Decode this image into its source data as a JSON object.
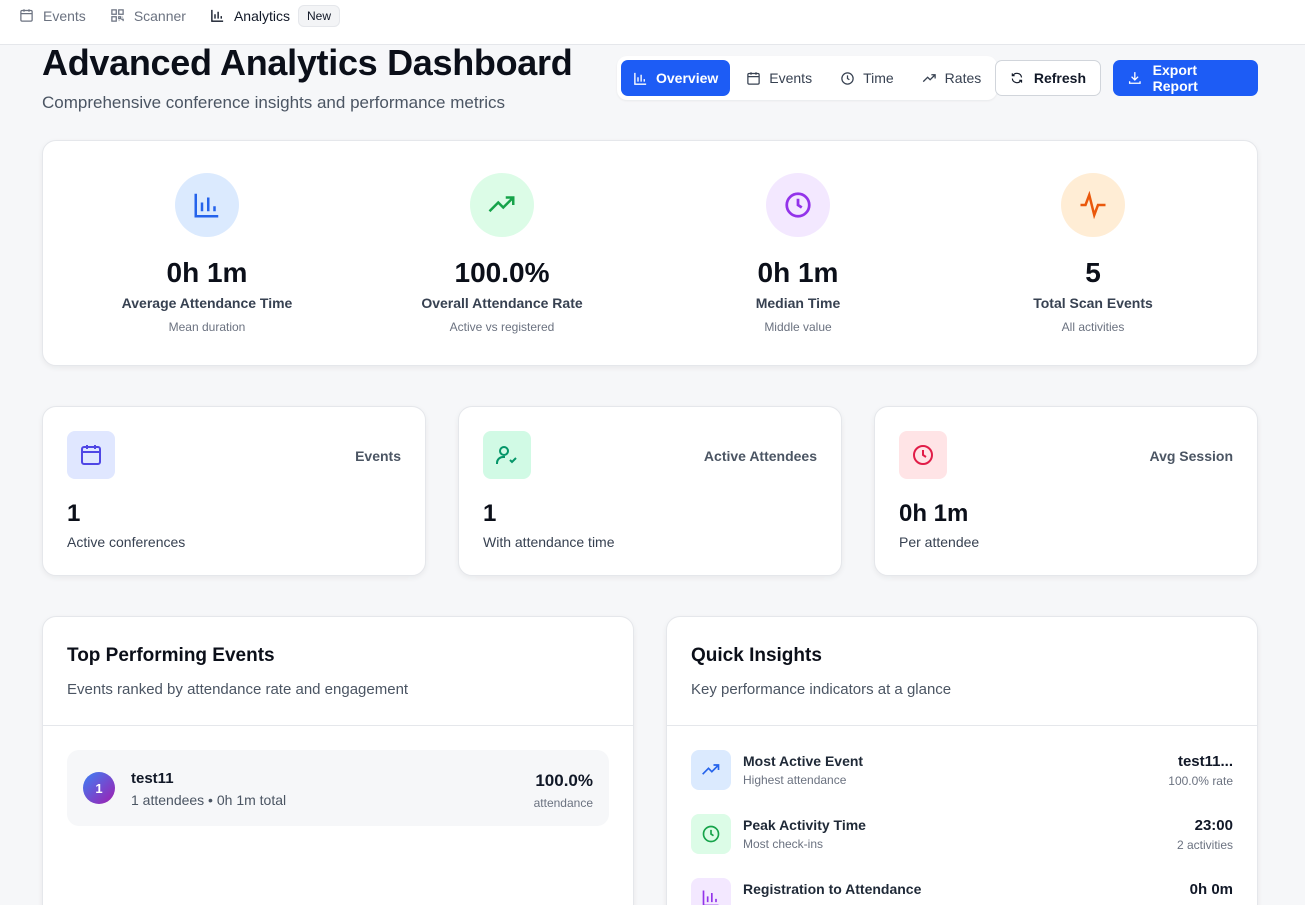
{
  "nav": {
    "items": [
      {
        "label": "Events",
        "icon": "calendar-icon"
      },
      {
        "label": "Scanner",
        "icon": "qr-code-icon"
      },
      {
        "label": "Analytics",
        "icon": "bar-chart-icon"
      }
    ],
    "badge": "New"
  },
  "header": {
    "title": "Advanced Analytics Dashboard",
    "subtitle": "Comprehensive conference insights and performance metrics"
  },
  "tabs": [
    {
      "label": "Overview",
      "icon": "bar-chart-icon",
      "active": true
    },
    {
      "label": "Events",
      "icon": "calendar-icon"
    },
    {
      "label": "Time",
      "icon": "clock-icon"
    },
    {
      "label": "Rates",
      "icon": "trending-up-icon"
    }
  ],
  "actions": {
    "refresh": "Refresh",
    "export": "Export Report"
  },
  "stats": [
    {
      "value": "0h 1m",
      "label": "Average Attendance Time",
      "sub": "Mean duration",
      "icon": "bar-chart-icon",
      "color": "#2563eb",
      "bg": "#dbeafe"
    },
    {
      "value": "100.0%",
      "label": "Overall Attendance Rate",
      "sub": "Active vs registered",
      "icon": "trending-up-icon",
      "color": "#16a34a",
      "bg": "#dcfce7"
    },
    {
      "value": "0h 1m",
      "label": "Median Time",
      "sub": "Middle value",
      "icon": "clock-icon",
      "color": "#9333ea",
      "bg": "#f3e8ff"
    },
    {
      "value": "5",
      "label": "Total Scan Events",
      "sub": "All activities",
      "icon": "activity-icon",
      "color": "#ea580c",
      "bg": "#ffedd5"
    }
  ],
  "mini_cards": [
    {
      "label": "Events",
      "value": "1",
      "sub": "Active conferences",
      "icon": "calendar-icon",
      "color": "#4f46e5",
      "bg": "#e0e7ff"
    },
    {
      "label": "Active Attendees",
      "value": "1",
      "sub": "With attendance time",
      "icon": "user-check-icon",
      "color": "#059669",
      "bg": "#d1fae5"
    },
    {
      "label": "Avg Session",
      "value": "0h 1m",
      "sub": "Per attendee",
      "icon": "clock-icon",
      "color": "#e11d48",
      "bg": "#ffe4e6"
    }
  ],
  "top_events": {
    "title": "Top Performing Events",
    "subtitle": "Events ranked by attendance rate and engagement",
    "rows": [
      {
        "rank": "1",
        "name": "test11",
        "meta": "1 attendees • 0h 1m total",
        "rate": "100.0%",
        "rate_label": "attendance"
      }
    ]
  },
  "insights": {
    "title": "Quick Insights",
    "subtitle": "Key performance indicators at a glance",
    "items": [
      {
        "title": "Most Active Event",
        "sub": "Highest attendance",
        "value": "test11...",
        "value_sub": "100.0% rate",
        "icon": "trending-up-icon",
        "color": "#2563eb",
        "bg": "#dbeafe"
      },
      {
        "title": "Peak Activity Time",
        "sub": "Most check-ins",
        "value": "23:00",
        "value_sub": "2 activities",
        "icon": "clock-icon",
        "color": "#16a34a",
        "bg": "#dcfce7"
      },
      {
        "title": "Registration to Attendance",
        "sub": "",
        "value": "0h 0m",
        "value_sub": "",
        "icon": "bar-chart-icon",
        "color": "#9333ea",
        "bg": "#f3e8ff"
      }
    ]
  }
}
